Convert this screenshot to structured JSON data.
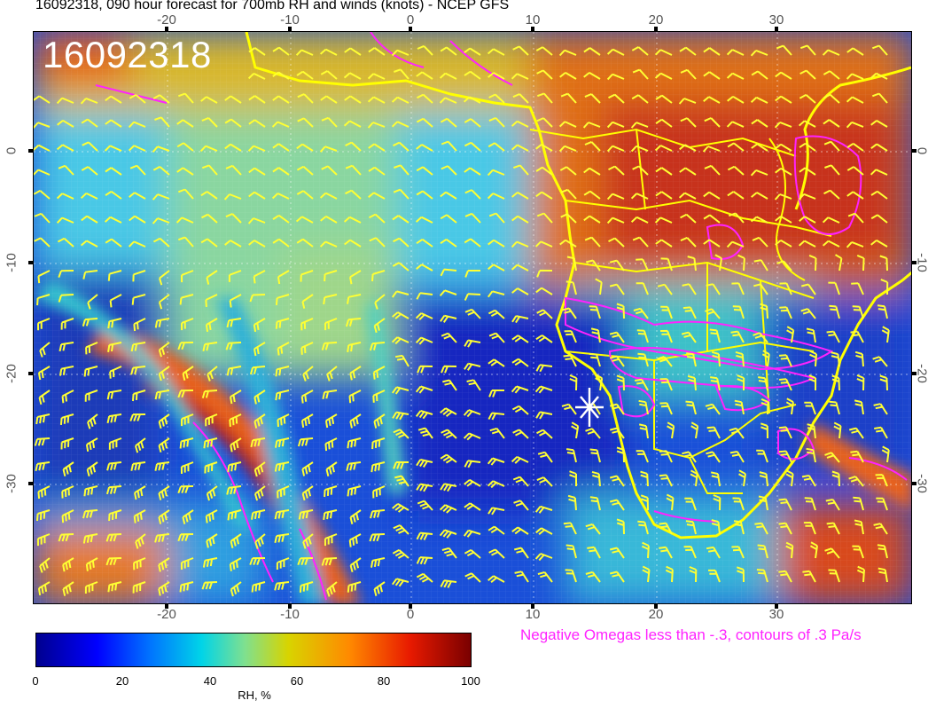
{
  "header": {
    "title": "16092318, 090 hour forecast for 700mb RH and winds (knots) - NCEP GFS"
  },
  "map": {
    "date_stamp": "16092318",
    "longitude_ticks": [
      "-20",
      "-10",
      "0",
      "10",
      "20",
      "30"
    ],
    "latitude_ticks": [
      "0",
      "-10",
      "-20",
      "-30"
    ],
    "station_marker": "star-marker",
    "colors": {
      "wind_barbs": "#ffff33",
      "coastlines": "#ffff00",
      "omega_contours": "#ff22ff",
      "station_marker": "#ffffff"
    }
  },
  "legend": {
    "omega_note": "Negative Omegas less than -.3, contours of .3 Pa/s",
    "colorbar_ticks": [
      "0",
      "20",
      "40",
      "60",
      "80",
      "100"
    ],
    "colorbar_title": "RH, %"
  }
}
